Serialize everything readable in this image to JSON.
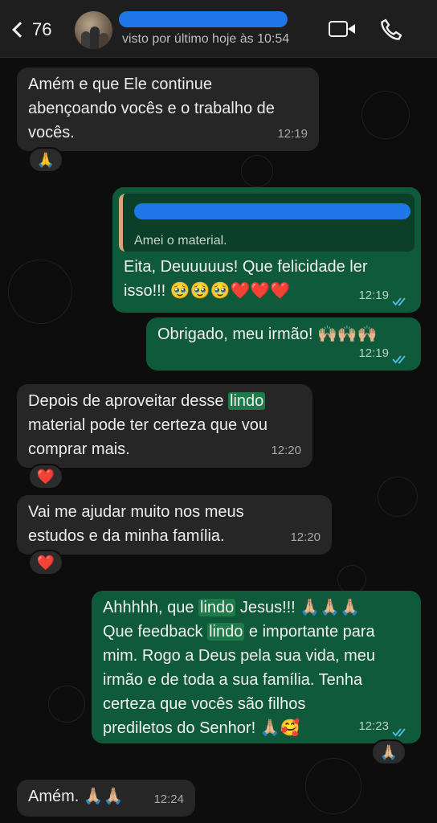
{
  "header": {
    "back_count": "76",
    "contact_name": "",
    "last_seen": "visto por último hoje às 10:54"
  },
  "messages": [
    {
      "id": "m1",
      "text": "Amém e que Ele continue abenço­ando vocês e o trabalho de vocês.",
      "lines": [
        "Amém e que Ele continue",
        "abençoando vocês e o trabalho de",
        "vocês."
      ],
      "time": "12:19",
      "reaction": "🙏"
    },
    {
      "id": "m2",
      "quote_author": "",
      "quote_text": "Amei o material.",
      "lines": [
        "Eita, Deuuuuus! Que felicidade ler",
        "isso!!! 🥹🥹🥹❤️❤️❤️"
      ],
      "time": "12:19"
    },
    {
      "id": "m3",
      "lines": [
        "Obrigado, meu irmão! 🙌🏼🙌🏼🙌🏼"
      ],
      "time": "12:19"
    },
    {
      "id": "m4",
      "line1_pre": "Depois de aproveitar desse ",
      "line1_hl": "lindo",
      "lines": [
        "material pode ter certeza que vou",
        "comprar mais."
      ],
      "time": "12:20",
      "reaction": "❤️"
    },
    {
      "id": "m5",
      "lines": [
        "Vai me ajudar muito nos meus",
        "estudos e da minha família."
      ],
      "time": "12:20",
      "reaction": "❤️"
    },
    {
      "id": "m6",
      "l1_pre": "Ahhhhh, que ",
      "l1_hl": "lindo",
      "l1_post": " Jesus!!! 🙏🏼🙏🏼🙏🏼",
      "l2_pre": "Que feedback ",
      "l2_hl": "lindo",
      "l2_post": " e importante para",
      "lines": [
        "mim. Rogo a Deus pela sua vida, meu",
        "irmão e de toda a sua família. Tenha",
        "certeza que vocês são filhos",
        "prediletos do Senhor! 🙏🏼🥰"
      ],
      "time": "12:23",
      "reaction": "🙏🏼"
    },
    {
      "id": "m7",
      "lines": [
        "Amém. 🙏🏼🙏🏼"
      ],
      "time": "12:24"
    }
  ],
  "colors": {
    "incoming_bubble": "#262626",
    "outgoing_bubble": "#0f5a3a",
    "read_ticks": "#53bdeb",
    "highlight": "#1f7a4a"
  },
  "icons": [
    "back-chevron-icon",
    "video-call-icon",
    "phone-call-icon",
    "double-check-icon"
  ]
}
